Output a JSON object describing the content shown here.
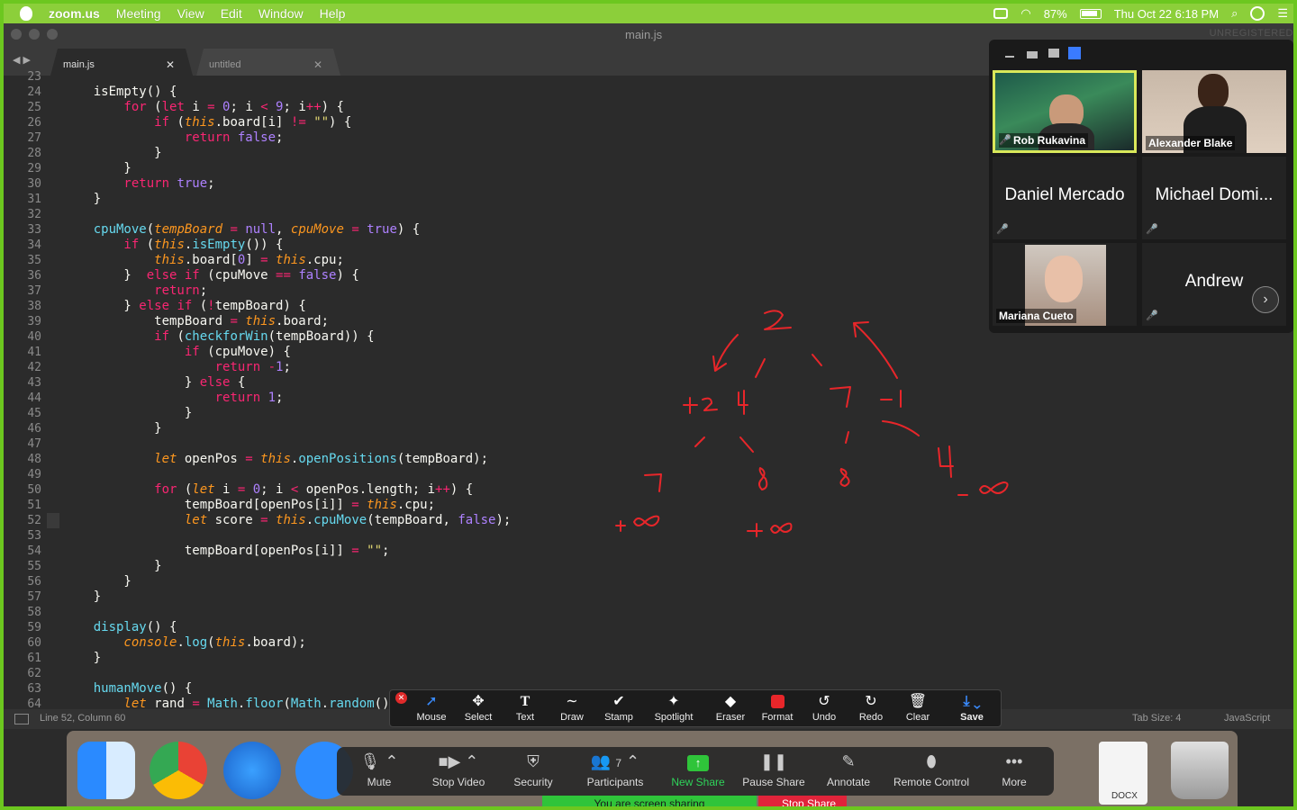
{
  "menubar": {
    "app": "zoom.us",
    "items": [
      "Meeting",
      "View",
      "Edit",
      "Window",
      "Help"
    ],
    "battery": "87%",
    "datetime": "Thu Oct 22  6:18 PM"
  },
  "window": {
    "title": "main.js",
    "unregistered": "UNREGISTERED"
  },
  "tabs": [
    {
      "label": "main.js"
    },
    {
      "label": "untitled"
    }
  ],
  "gutter": [
    "23",
    "24",
    "25",
    "26",
    "27",
    "28",
    "29",
    "30",
    "31",
    "32",
    "33",
    "34",
    "35",
    "36",
    "37",
    "38",
    "39",
    "40",
    "41",
    "42",
    "43",
    "44",
    "45",
    "46",
    "47",
    "48",
    "49",
    "50",
    "51",
    "52",
    "53",
    "54",
    "55",
    "56",
    "57",
    "58",
    "59",
    "60",
    "61",
    "62",
    "63",
    "64"
  ],
  "code": [
    [],
    [
      [
        "pl",
        "    isEmpty() {"
      ]
    ],
    [
      [
        "kw",
        "        for "
      ],
      [
        "pl",
        "("
      ],
      [
        "kw",
        "let "
      ],
      [
        "pl",
        "i "
      ],
      [
        "kw",
        "= "
      ],
      [
        "nm",
        "0"
      ],
      [
        "pl",
        "; i "
      ],
      [
        "kw",
        "< "
      ],
      [
        "nm",
        "9"
      ],
      [
        "pl",
        "; i"
      ],
      [
        "kw",
        "++"
      ],
      [
        "pl",
        ") {"
      ]
    ],
    [
      [
        "kw",
        "            if "
      ],
      [
        "pl",
        "("
      ],
      [
        "th",
        "this"
      ],
      [
        "pl",
        ".board[i] "
      ],
      [
        "kw",
        "!= "
      ],
      [
        "st",
        "\"\""
      ],
      [
        "pl",
        ") {"
      ]
    ],
    [
      [
        "kw",
        "                return "
      ],
      [
        "nm",
        "false"
      ],
      [
        "pl",
        ";"
      ]
    ],
    [
      [
        "pl",
        "            }"
      ]
    ],
    [
      [
        "pl",
        "        }"
      ]
    ],
    [
      [
        "kw",
        "        return "
      ],
      [
        "nm",
        "true"
      ],
      [
        "pl",
        ";"
      ]
    ],
    [
      [
        "pl",
        "    }"
      ]
    ],
    [],
    [
      [
        "fn",
        "    cpuMove"
      ],
      [
        "pl",
        "("
      ],
      [
        "pr",
        "tempBoard "
      ],
      [
        "kw",
        "= "
      ],
      [
        "nm",
        "null"
      ],
      [
        "pl",
        ", "
      ],
      [
        "pr",
        "cpuMove "
      ],
      [
        "kw",
        "= "
      ],
      [
        "nm",
        "true"
      ],
      [
        "pl",
        ") {"
      ]
    ],
    [
      [
        "kw",
        "        if "
      ],
      [
        "pl",
        "("
      ],
      [
        "th",
        "this"
      ],
      [
        "pl",
        "."
      ],
      [
        "fn",
        "isEmpty"
      ],
      [
        "pl",
        "()) {"
      ]
    ],
    [
      [
        "th",
        "            this"
      ],
      [
        "pl",
        ".board["
      ],
      [
        "nm",
        "0"
      ],
      [
        "pl",
        "] "
      ],
      [
        "kw",
        "= "
      ],
      [
        "th",
        "this"
      ],
      [
        "pl",
        ".cpu;"
      ]
    ],
    [
      [
        "pl",
        "        }  "
      ],
      [
        "kw",
        "else if "
      ],
      [
        "pl",
        "(cpuMove "
      ],
      [
        "kw",
        "== "
      ],
      [
        "nm",
        "false"
      ],
      [
        "pl",
        ") {"
      ]
    ],
    [
      [
        "kw",
        "            return"
      ],
      [
        "pl",
        ";"
      ]
    ],
    [
      [
        "pl",
        "        } "
      ],
      [
        "kw",
        "else if "
      ],
      [
        "pl",
        "("
      ],
      [
        "kw",
        "!"
      ],
      [
        "pl",
        "tempBoard) {"
      ]
    ],
    [
      [
        "pl",
        "            tempBoard "
      ],
      [
        "kw",
        "= "
      ],
      [
        "th",
        "this"
      ],
      [
        "pl",
        ".board;"
      ]
    ],
    [
      [
        "kw",
        "            if "
      ],
      [
        "pl",
        "("
      ],
      [
        "fn",
        "checkforWin"
      ],
      [
        "pl",
        "(tempBoard)) {"
      ]
    ],
    [
      [
        "kw",
        "                if "
      ],
      [
        "pl",
        "(cpuMove) {"
      ]
    ],
    [
      [
        "kw",
        "                    return "
      ],
      [
        "kw",
        "-"
      ],
      [
        "nm",
        "1"
      ],
      [
        "pl",
        ";"
      ]
    ],
    [
      [
        "pl",
        "                } "
      ],
      [
        "kw",
        "else "
      ],
      [
        "pl",
        "{"
      ]
    ],
    [
      [
        "kw",
        "                    return "
      ],
      [
        "nm",
        "1"
      ],
      [
        "pl",
        ";"
      ]
    ],
    [
      [
        "pl",
        "                }"
      ]
    ],
    [
      [
        "pl",
        "            }"
      ]
    ],
    [],
    [
      [
        "th",
        "            let "
      ],
      [
        "pl",
        "openPos "
      ],
      [
        "kw",
        "= "
      ],
      [
        "th",
        "this"
      ],
      [
        "pl",
        "."
      ],
      [
        "fn",
        "openPositions"
      ],
      [
        "pl",
        "(tempBoard);"
      ]
    ],
    [],
    [
      [
        "kw",
        "            for "
      ],
      [
        "pl",
        "("
      ],
      [
        "th",
        "let "
      ],
      [
        "pl",
        "i "
      ],
      [
        "kw",
        "= "
      ],
      [
        "nm",
        "0"
      ],
      [
        "pl",
        "; i "
      ],
      [
        "kw",
        "< "
      ],
      [
        "pl",
        "openPos.length; i"
      ],
      [
        "kw",
        "++"
      ],
      [
        "pl",
        ") {"
      ]
    ],
    [
      [
        "pl",
        "                tempBoard[openPos[i]] "
      ],
      [
        "kw",
        "= "
      ],
      [
        "th",
        "this"
      ],
      [
        "pl",
        ".cpu;"
      ]
    ],
    [
      [
        "th",
        "                let "
      ],
      [
        "pl",
        "score "
      ],
      [
        "kw",
        "= "
      ],
      [
        "th",
        "this"
      ],
      [
        "pl",
        "."
      ],
      [
        "fn",
        "cpuMove"
      ],
      [
        "pl",
        "(tempBoard, "
      ],
      [
        "nm",
        "false"
      ],
      [
        "pl",
        ");"
      ]
    ],
    [],
    [
      [
        "pl",
        "                tempBoard[openPos[i]] "
      ],
      [
        "kw",
        "= "
      ],
      [
        "st",
        "\"\""
      ],
      [
        "pl",
        ";"
      ]
    ],
    [
      [
        "pl",
        "            }"
      ]
    ],
    [
      [
        "pl",
        "        }"
      ]
    ],
    [
      [
        "pl",
        "    }"
      ]
    ],
    [],
    [
      [
        "fn",
        "    display"
      ],
      [
        "pl",
        "() {"
      ]
    ],
    [
      [
        "th",
        "        console"
      ],
      [
        "pl",
        "."
      ],
      [
        "fn",
        "log"
      ],
      [
        "pl",
        "("
      ],
      [
        "th",
        "this"
      ],
      [
        "pl",
        ".board);"
      ]
    ],
    [
      [
        "pl",
        "    }"
      ]
    ],
    [],
    [
      [
        "fn",
        "    humanMove"
      ],
      [
        "pl",
        "() {"
      ]
    ],
    [
      [
        "th",
        "        let "
      ],
      [
        "pl",
        "rand "
      ],
      [
        "kw",
        "= "
      ],
      [
        "fn",
        "Math"
      ],
      [
        "pl",
        "."
      ],
      [
        "fn",
        "floor"
      ],
      [
        "pl",
        "("
      ],
      [
        "fn",
        "Math"
      ],
      [
        "pl",
        "."
      ],
      [
        "fn",
        "random"
      ],
      [
        "pl",
        "() "
      ],
      [
        "kw",
        "*"
      ]
    ]
  ],
  "status": {
    "position": "Line 52, Column 60",
    "tabsize": "Tab Size: 4",
    "syntax": "JavaScript"
  },
  "annotation_tools": [
    "Mouse",
    "Select",
    "Text",
    "Draw",
    "Stamp",
    "Spotlight",
    "Eraser",
    "Format",
    "Undo",
    "Redo",
    "Clear",
    "Save"
  ],
  "participants": [
    {
      "name": "Rob Rukavina",
      "type": "video"
    },
    {
      "name": "Alexander Blake",
      "type": "video"
    },
    {
      "name": "Daniel Mercado",
      "type": "name"
    },
    {
      "name": "Michael Domi...",
      "type": "name"
    },
    {
      "name": "Mariana Cueto",
      "type": "video"
    },
    {
      "name": "Andrew",
      "type": "name"
    }
  ],
  "meeting_controls": [
    "Mute",
    "Stop Video",
    "Security",
    "Participants",
    "New Share",
    "Pause Share",
    "Annotate",
    "Remote Control",
    "More"
  ],
  "participant_count": "7",
  "share_status": "You are screen sharing",
  "stop_share": "Stop Share",
  "dock_docx": "DOCX",
  "colors": {
    "accent": "#7dcf2e",
    "annotation": "#e8262a",
    "share_green": "#2fc43a"
  }
}
